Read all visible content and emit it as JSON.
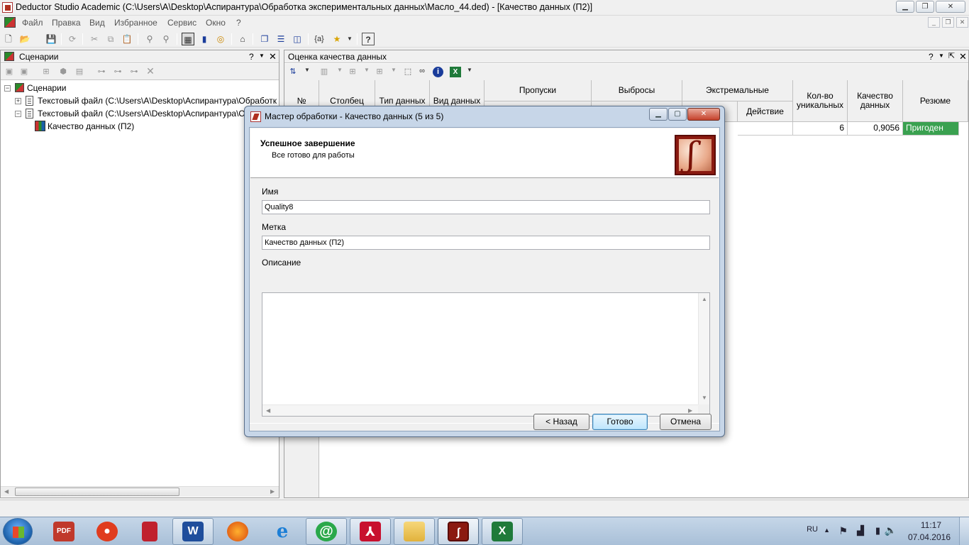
{
  "window": {
    "title": "Deductor Studio Academic (C:\\Users\\A\\Desktop\\Аспирантура\\Обработка экспериментальных данных\\Масло_44.ded) - [Качество данных (П2)]"
  },
  "menu": [
    "Файл",
    "Правка",
    "Вид",
    "Избранное",
    "Сервис",
    "Окно",
    "?"
  ],
  "left_pane": {
    "title": "Сценарии",
    "help": "?",
    "tree": [
      {
        "label": "Сценарии"
      },
      {
        "label": "Текстовый файл (C:\\Users\\A\\Desktop\\Аспирантура\\Обработка экс"
      },
      {
        "label": "Текстовый файл (C:\\Users\\A\\Desktop\\Аспирантура\\Обраб"
      },
      {
        "label": "Качество данных (П2)"
      }
    ]
  },
  "right_pane": {
    "title": "Оценка качества данных",
    "help": "?",
    "columns": {
      "num": "№",
      "column": "Столбец",
      "data_type": "Тип данных",
      "data_kind": "Вид данных",
      "gaps": "Пропуски",
      "outliers": "Выбросы",
      "extremes": "Экстремальные",
      "action": "Действие",
      "unique_count": "Кол-во уникальных",
      "quality": "Качество данных",
      "summary": "Резюме"
    },
    "row": {
      "unique_count": "6",
      "quality": "0,9056",
      "summary": "Пригоден"
    },
    "status_colors": {
      "good": "#3aa150"
    }
  },
  "dialog": {
    "title": "Мастер обработки - Качество данных (5 из 5)",
    "heading": "Успешное завершение",
    "subheading": "Все готово для работы",
    "name_label": "Имя",
    "name_value": "Quality8",
    "tag_label": "Метка",
    "tag_value": "Качество данных (П2)",
    "desc_label": "Описание",
    "desc_value": "",
    "back_label": "< Назад",
    "finish_label": "Готово",
    "cancel_label": "Отмена"
  },
  "taskbar": {
    "lang": "RU",
    "time": "11:17",
    "date": "07.04.2016"
  }
}
